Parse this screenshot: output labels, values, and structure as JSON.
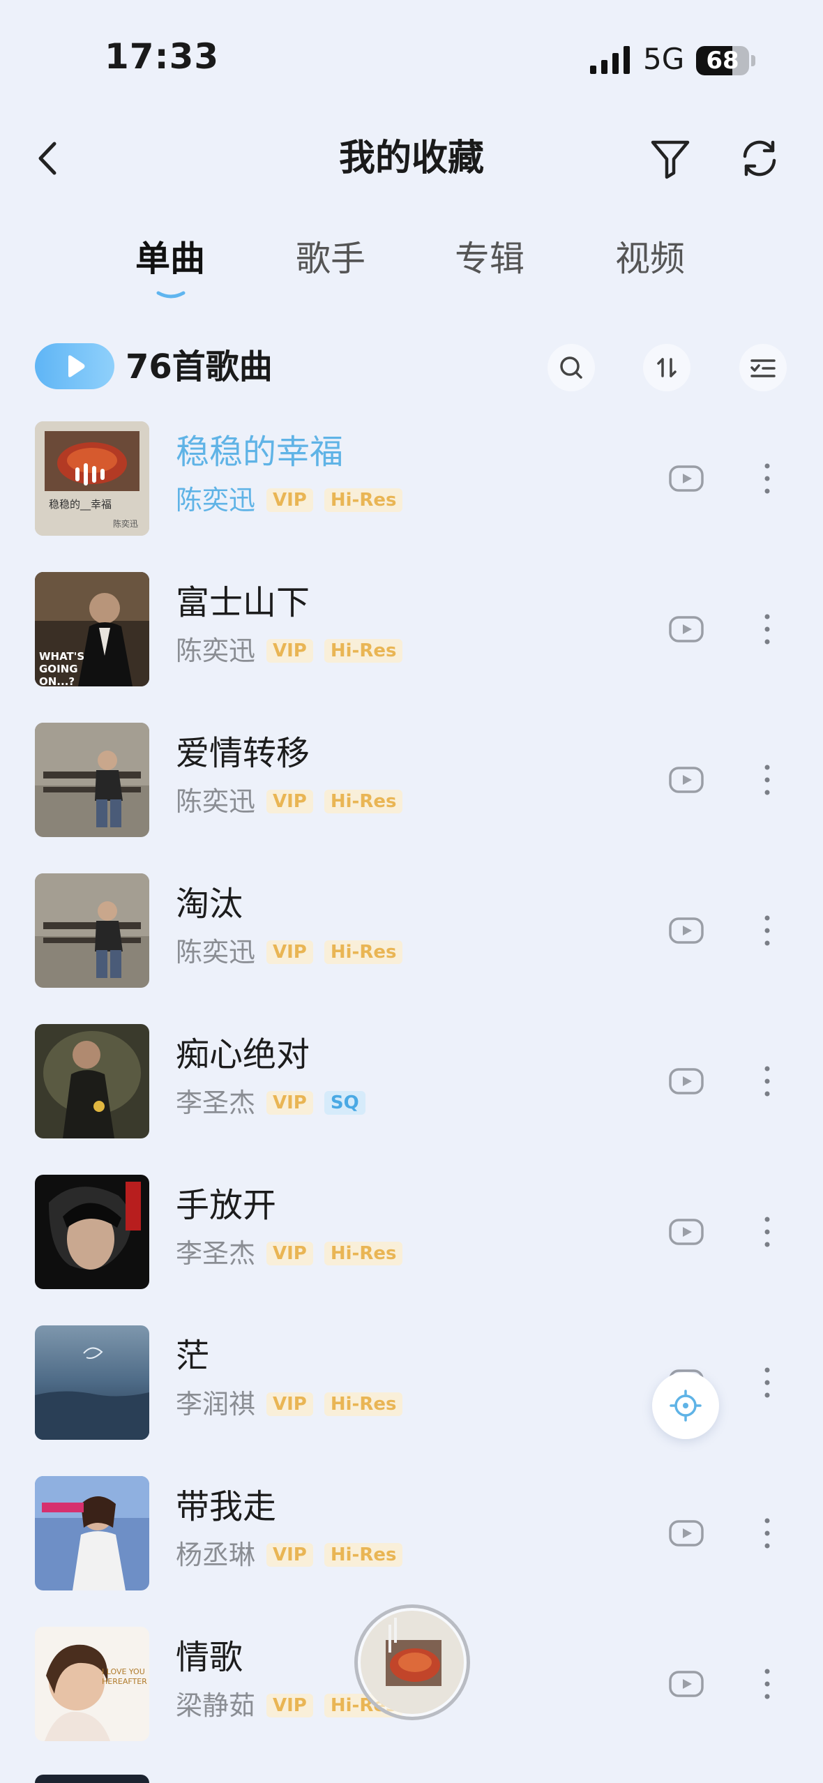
{
  "status_bar": {
    "time": "17:33",
    "network": "5G",
    "battery": "68",
    "battery_level": 0.68
  },
  "header": {
    "title": "我的收藏"
  },
  "tabs": [
    {
      "label": "单曲",
      "active": true
    },
    {
      "label": "歌手",
      "active": false
    },
    {
      "label": "专辑",
      "active": false
    },
    {
      "label": "视频",
      "active": false
    }
  ],
  "toolbar": {
    "count_label": "76首歌曲"
  },
  "songs": [
    {
      "title": "稳稳的幸福",
      "artist": "陈奕迅",
      "vip": "VIP",
      "quality": "Hi-Res",
      "playing": true
    },
    {
      "title": "富士山下",
      "artist": "陈奕迅",
      "vip": "VIP",
      "quality": "Hi-Res"
    },
    {
      "title": "爱情转移",
      "artist": "陈奕迅",
      "vip": "VIP",
      "quality": "Hi-Res"
    },
    {
      "title": "淘汰",
      "artist": "陈奕迅",
      "vip": "VIP",
      "quality": "Hi-Res"
    },
    {
      "title": "痴心绝对",
      "artist": "李圣杰",
      "vip": "VIP",
      "quality": "SQ"
    },
    {
      "title": "手放开",
      "artist": "李圣杰",
      "vip": "VIP",
      "quality": "Hi-Res"
    },
    {
      "title": "茫",
      "artist": "李润祺",
      "vip": "VIP",
      "quality": "Hi-Res"
    },
    {
      "title": "带我走",
      "artist": "杨丞琳",
      "vip": "VIP",
      "quality": "Hi-Res"
    },
    {
      "title": "情歌",
      "artist": "梁静茹",
      "vip": "VIP",
      "quality": "Hi-Res"
    }
  ],
  "album_covers": {
    "0": {
      "label_top": "稳稳的__幸福",
      "label_bottom": "陈奕迅"
    },
    "1": {
      "label": "WHAT'S GOING ON...?"
    },
    "8": {
      "label": "I LOVE YOU HEREAFTER"
    }
  },
  "colors": {
    "accent": "#5fb3e6",
    "vip": "#e9b554",
    "background": "#edf1fa"
  }
}
